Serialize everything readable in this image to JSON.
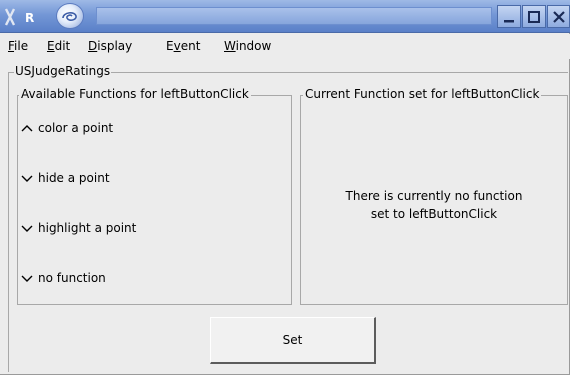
{
  "window": {
    "app_badge": "R",
    "icons": {
      "app": "x-r-app-icon",
      "swirl": "swirl-icon",
      "minimize": "minimize-icon",
      "maximize": "maximize-icon",
      "close": "close-icon"
    },
    "colors": {
      "titlebar": "#7497d6",
      "background": "#ececec"
    }
  },
  "menu": {
    "items": [
      {
        "prefix": "",
        "accel": "F",
        "suffix": "ile"
      },
      {
        "prefix": "",
        "accel": "E",
        "suffix": "dit"
      },
      {
        "prefix": "",
        "accel": "D",
        "suffix": "isplay"
      },
      {
        "prefix": "E",
        "accel": "v",
        "suffix": "ent"
      },
      {
        "prefix": "",
        "accel": "W",
        "suffix": "indow"
      }
    ]
  },
  "frame_title": "USJudgeRatings",
  "available": {
    "title": "Available Functions for leftButtonClick",
    "items": [
      {
        "label": "color a point",
        "icon": "chevron-up-icon"
      },
      {
        "label": "hide a point",
        "icon": "chevron-down-icon"
      },
      {
        "label": "highlight a point",
        "icon": "chevron-down-icon"
      },
      {
        "label": "no function",
        "icon": "chevron-down-icon"
      }
    ]
  },
  "current": {
    "title": "Current Function set for leftButtonClick",
    "message_line1": "There is currently no function",
    "message_line2": "set to leftButtonClick"
  },
  "set_button": {
    "label": "Set"
  }
}
